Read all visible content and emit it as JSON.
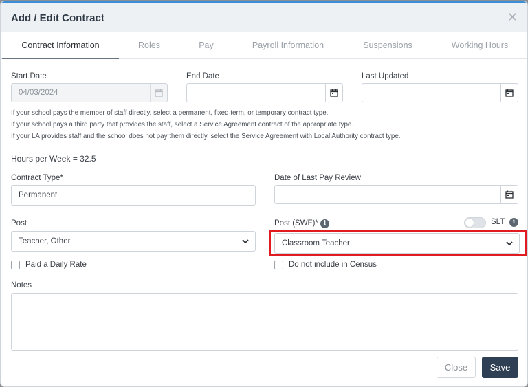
{
  "modal": {
    "title": "Add / Edit Contract",
    "close_icon": "close-icon"
  },
  "tabs": [
    {
      "label": "Contract Information",
      "active": true
    },
    {
      "label": "Roles",
      "active": false
    },
    {
      "label": "Pay",
      "active": false
    },
    {
      "label": "Payroll Information",
      "active": false
    },
    {
      "label": "Suspensions",
      "active": false
    },
    {
      "label": "Working Hours",
      "active": false
    }
  ],
  "fields": {
    "start_date": {
      "label": "Start Date",
      "value": "04/03/2024"
    },
    "end_date": {
      "label": "End Date",
      "value": ""
    },
    "last_updated": {
      "label": "Last Updated",
      "value": ""
    },
    "contract_type": {
      "label": "Contract Type*",
      "value": "Permanent"
    },
    "date_last_pay_review": {
      "label": "Date of Last Pay Review",
      "value": ""
    },
    "post": {
      "label": "Post",
      "value": "Teacher, Other"
    },
    "post_swf": {
      "label": "Post (SWF)*",
      "value": "Classroom Teacher"
    },
    "slt": {
      "label": "SLT",
      "on": false
    },
    "notes": {
      "label": "Notes",
      "value": ""
    }
  },
  "help_text": [
    "If your school pays the member of staff directly, select a permanent, fixed term, or temporary contract type.",
    "If your school pays a third party that provides the staff, select a Service Agreement contract of the appropriate type.",
    "If your LA provides staff and the school does not pay them directly, select the Service Agreement with Local Authority contract type."
  ],
  "hours_per_week": "Hours per Week = 32.5",
  "checkboxes": {
    "paid_daily_rate": {
      "label": "Paid a Daily Rate",
      "checked": false
    },
    "not_in_census": {
      "label": "Do not include in Census",
      "checked": false
    }
  },
  "buttons": {
    "close": "Close",
    "save": "Save"
  },
  "colors": {
    "accent": "#3b8fd9",
    "save_button": "#2f4054",
    "highlight": "#e11b22"
  }
}
